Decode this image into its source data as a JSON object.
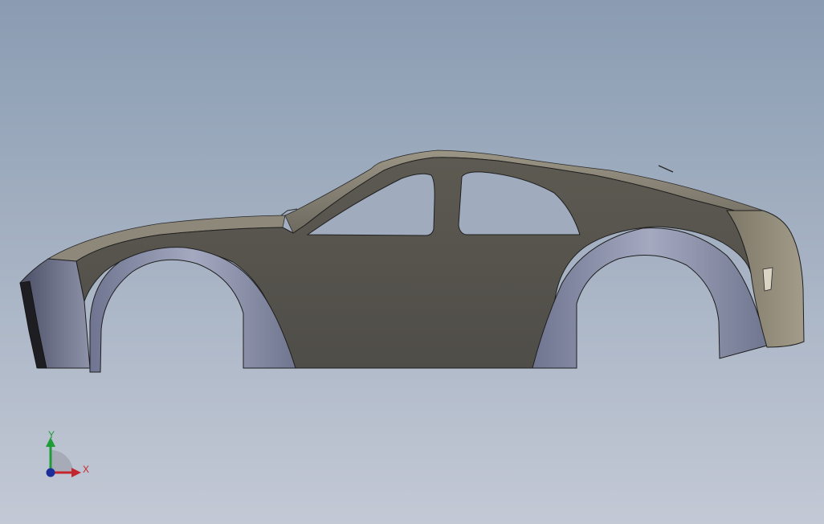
{
  "viewport": {
    "background_top": "#8a9cb2",
    "background_bottom": "#c3c9d5"
  },
  "model": {
    "body_panel_color": "#58564f",
    "body_panel_dark": "#4b4944",
    "fender_color_light": "#9aa0b8",
    "fender_color_dark": "#6f7590",
    "trim_color": "#8d8778",
    "window_color": "#a0acbe",
    "outline_color": "#1f1f1f"
  },
  "triad": {
    "x_label": "X",
    "y_label": "Y",
    "x_color": "#c4262e",
    "y_color": "#1f9b37",
    "z_color": "#1b2e9a"
  }
}
